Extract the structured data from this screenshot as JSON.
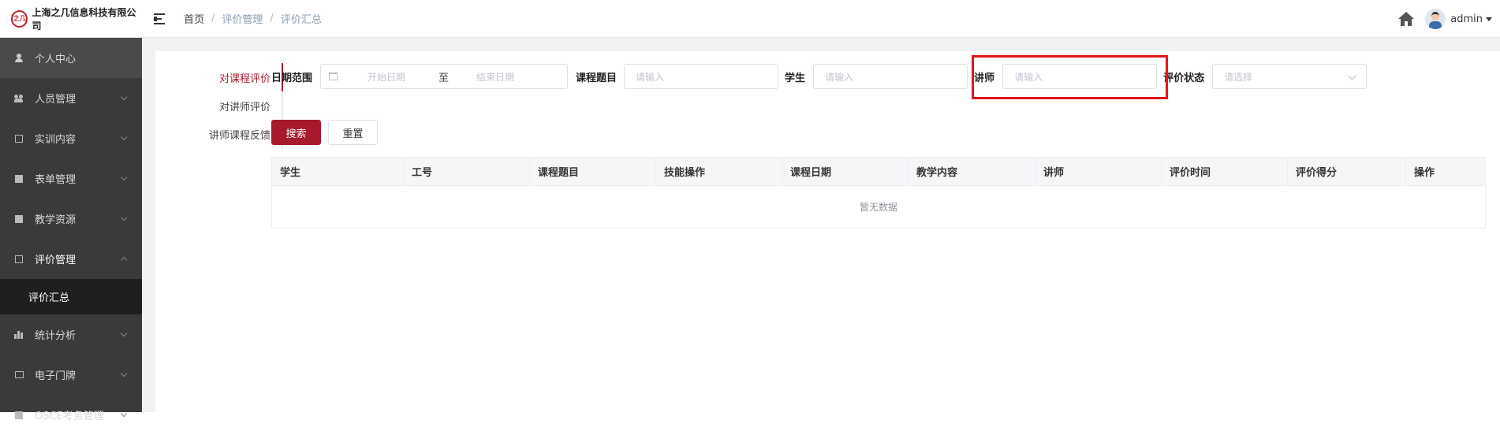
{
  "header": {
    "logo_mark": "之几",
    "company_name": "上海之几信息科技有限公司",
    "breadcrumb": [
      "首页",
      "评价管理",
      "评价汇总"
    ],
    "breadcrumb_separator": "/",
    "username": "admin"
  },
  "sidebar": {
    "items": [
      {
        "label": "个人中心",
        "icon": "user-icon"
      },
      {
        "label": "人员管理",
        "icon": "users-icon"
      },
      {
        "label": "实训内容",
        "icon": "training-icon"
      },
      {
        "label": "表单管理",
        "icon": "form-icon"
      },
      {
        "label": "教学资源",
        "icon": "resource-icon"
      },
      {
        "label": "评价管理",
        "icon": "evaluation-icon",
        "expanded": true
      },
      {
        "label": "统计分析",
        "icon": "chart-icon"
      },
      {
        "label": "电子门牌",
        "icon": "screen-icon"
      },
      {
        "label": "OSCE考务管理",
        "icon": "exam-icon"
      }
    ],
    "active_sub_item": "评价汇总"
  },
  "tabs": [
    {
      "label": "对课程评价",
      "active": true
    },
    {
      "label": "对讲师评价",
      "active": false
    },
    {
      "label": "讲师课程反馈",
      "active": false
    }
  ],
  "filters": {
    "date_range_label": "日期范围",
    "date_start_placeholder": "开始日期",
    "date_to": "至",
    "date_end_placeholder": "结束日期",
    "course_label": "课程题目",
    "course_placeholder": "请输入",
    "student_label": "学生",
    "student_placeholder": "请输入",
    "lecturer_label": "讲师",
    "lecturer_placeholder": "请输入",
    "status_label": "评价状态",
    "status_placeholder": "请选择"
  },
  "buttons": {
    "search": "搜索",
    "reset": "重置"
  },
  "table": {
    "columns": [
      "学生",
      "工号",
      "课程题目",
      "技能操作",
      "课程日期",
      "教学内容",
      "讲师",
      "评价时间",
      "评价得分",
      "操作"
    ],
    "empty_text": "暂无数据"
  },
  "colors": {
    "primary": "#a8192d",
    "highlight": "#e0161c",
    "sidebar_bg": "#3a3a3a"
  }
}
